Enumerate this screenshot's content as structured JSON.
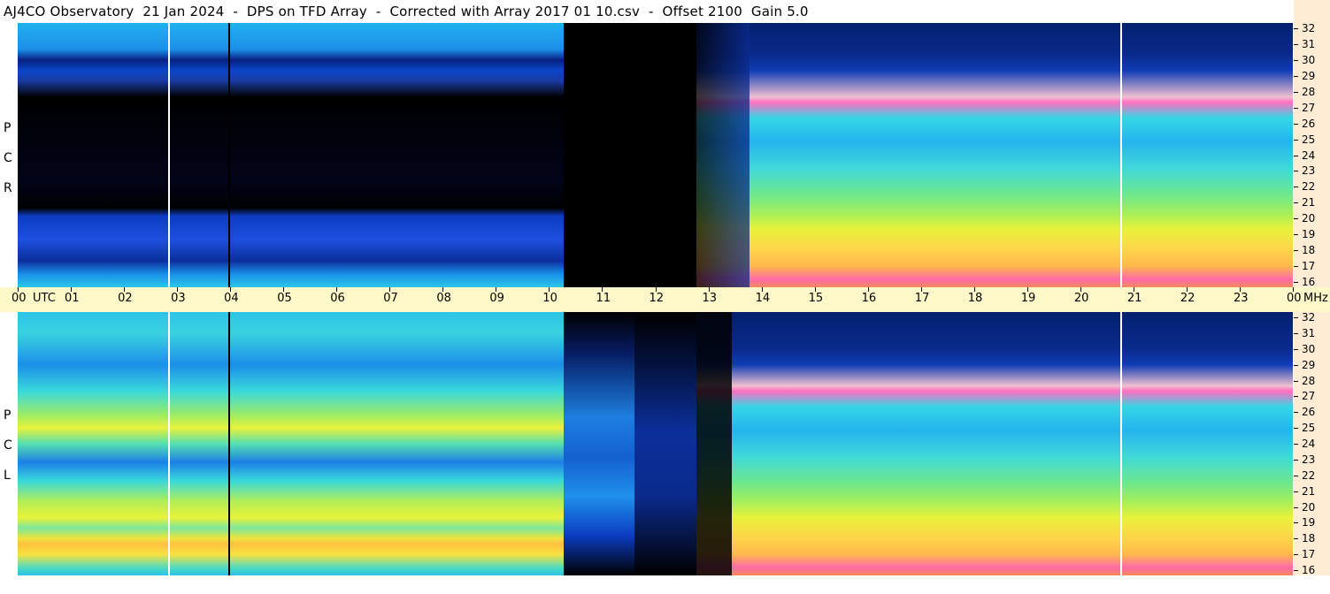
{
  "title": "AJ4CO Observatory  21 Jan 2024  -  DPS on TFD Array  -  Corrected with Array 2017 01 10.csv  -  Offset 2100  Gain 5.0",
  "panels": {
    "top_label": [
      "R",
      "C",
      "P"
    ],
    "bottom_label": [
      "L",
      "C",
      "P"
    ]
  },
  "chart_data": {
    "type": "heatmap",
    "title": "AJ4CO Observatory  21 Jan 2024  -  DPS on TFD Array  -  Corrected with Array 2017 01 10.csv  -  Offset 2100  Gain 5.0",
    "x_tick_labels": [
      "00",
      "UTC",
      "01",
      "02",
      "03",
      "04",
      "05",
      "06",
      "07",
      "08",
      "09",
      "10",
      "11",
      "12",
      "13",
      "14",
      "15",
      "16",
      "17",
      "18",
      "19",
      "20",
      "21",
      "22",
      "23",
      "00",
      "MHz"
    ],
    "x_hours": [
      0,
      1,
      2,
      3,
      4,
      5,
      6,
      7,
      8,
      9,
      10,
      11,
      12,
      13,
      14,
      15,
      16,
      17,
      18,
      19,
      20,
      21,
      22,
      23,
      24
    ],
    "y_tick_labels": [
      "32",
      "31",
      "30",
      "29",
      "28",
      "27",
      "26",
      "25",
      "24",
      "23",
      "22",
      "21",
      "20",
      "19",
      "18",
      "17",
      "16"
    ],
    "y_range_mhz": [
      16,
      32
    ],
    "x_range_utc": [
      0,
      24
    ],
    "panels": [
      "RCP",
      "LCP"
    ],
    "colormap": [
      "#000000",
      "#0a1a6e",
      "#1d4fe0",
      "#22b6f0",
      "#2fe2e0",
      "#7df07a",
      "#e6f23a",
      "#ffc040",
      "#ff4fa0",
      "#ffffff"
    ],
    "notable_vertical_lines_utc": [
      2.83,
      3.97,
      20.77
    ]
  }
}
